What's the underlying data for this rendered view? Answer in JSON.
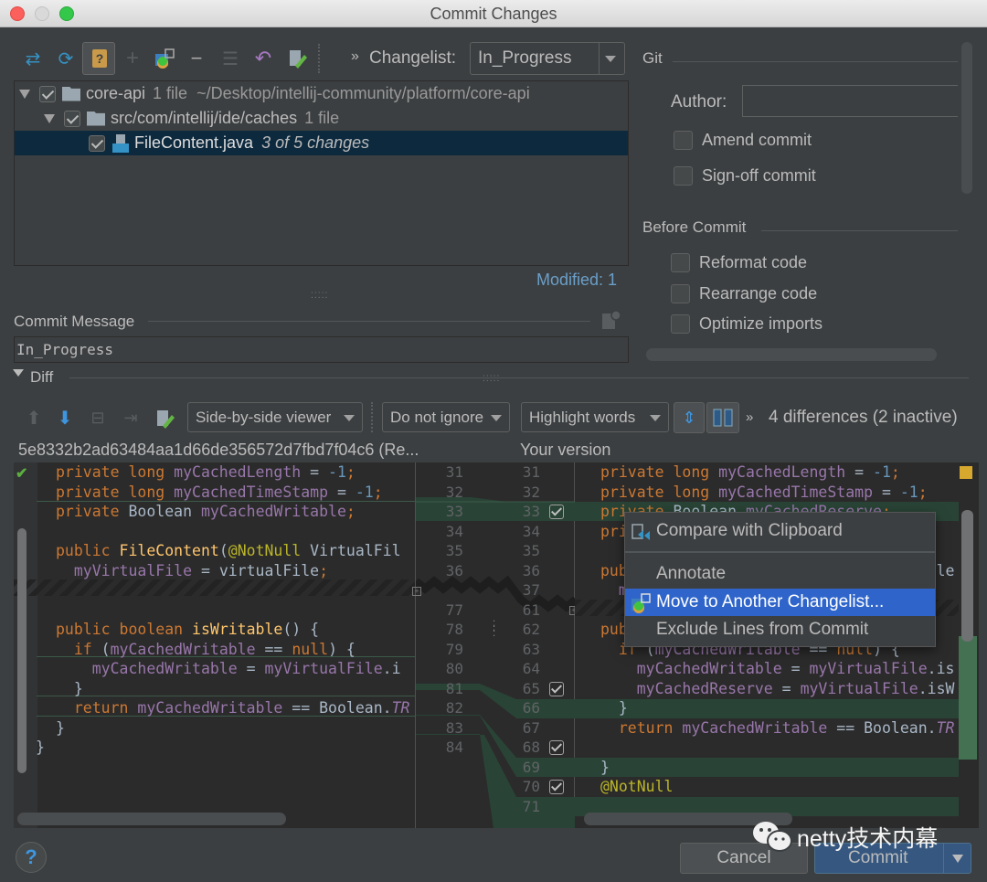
{
  "window": {
    "title": "Commit Changes"
  },
  "toolbar": {
    "icons": [
      "show-diff-icon",
      "refresh-icon",
      "unversioned-files-icon",
      "add-icon",
      "move-to-changelist-icon",
      "remove-icon",
      "group-by-icon",
      "rollback-icon",
      "edit-source-icon"
    ],
    "more": "»",
    "changelist_label": "Changelist:",
    "changelist_value": "In_Progress"
  },
  "tree": {
    "rows": [
      {
        "name": "core-api",
        "meta": "1 file",
        "path": "~/Desktop/intellij-community/platform/core-api",
        "checked": true,
        "expanded": true
      },
      {
        "name": "src/com/intellij/ide/caches",
        "meta": "1 file",
        "checked": true,
        "expanded": true
      },
      {
        "name": "FileContent.java",
        "meta": "3 of 5 changes",
        "checked": true,
        "selected": true
      }
    ],
    "modified": "Modified: 1"
  },
  "commit_message": {
    "label": "Commit Message",
    "value": "In_Progress"
  },
  "git": {
    "section": "Git",
    "author_label": "Author:",
    "author_value": "",
    "amend": {
      "label": "Amend commit",
      "checked": false
    },
    "signoff": {
      "label": "Sign-off commit",
      "checked": false
    }
  },
  "before_commit": {
    "section": "Before Commit",
    "options": [
      {
        "label": "Reformat code",
        "checked": false
      },
      {
        "label": "Rearrange code",
        "checked": false
      },
      {
        "label": "Optimize imports",
        "checked": false
      }
    ]
  },
  "diff": {
    "label": "Diff",
    "viewer": "Side-by-side viewer",
    "ignore": "Do not ignore",
    "highlight": "Highlight words",
    "more": "»",
    "summary": "4 differences (2 inactive)",
    "left_title": "5e8332b2ad63484aa1d66de356572d7fbd7f04c6 (Re...",
    "right_title": "Your version",
    "left_lines": [
      "31",
      "32",
      "33",
      "34",
      "35",
      "36",
      "77",
      "78",
      "79",
      "80",
      "81",
      "82",
      "83",
      "84"
    ],
    "right_lines": [
      "31",
      "32",
      "33",
      "34",
      "35",
      "36",
      "37",
      "61",
      "62",
      "63",
      "64",
      "65",
      "66",
      "67",
      "68",
      "69",
      "70",
      "71"
    ],
    "checked_right_lines": [
      "33",
      "65",
      "68",
      "70"
    ]
  },
  "context_menu": {
    "items": [
      {
        "label": "Compare with Clipboard",
        "icon": "compare-clipboard-icon"
      },
      {
        "label": "Annotate"
      },
      {
        "label": "Move to Another Changelist...",
        "icon": "move-to-changelist-icon",
        "selected": true
      },
      {
        "label": "Exclude Lines from Commit"
      }
    ]
  },
  "footer": {
    "help": "?",
    "cancel": "Cancel",
    "commit": "Commit",
    "watermark": "netty技术内幕"
  },
  "colors": {
    "accent": "#2f65ca",
    "selection": "#0d293e",
    "added": "#294436",
    "link": "#589df6"
  }
}
